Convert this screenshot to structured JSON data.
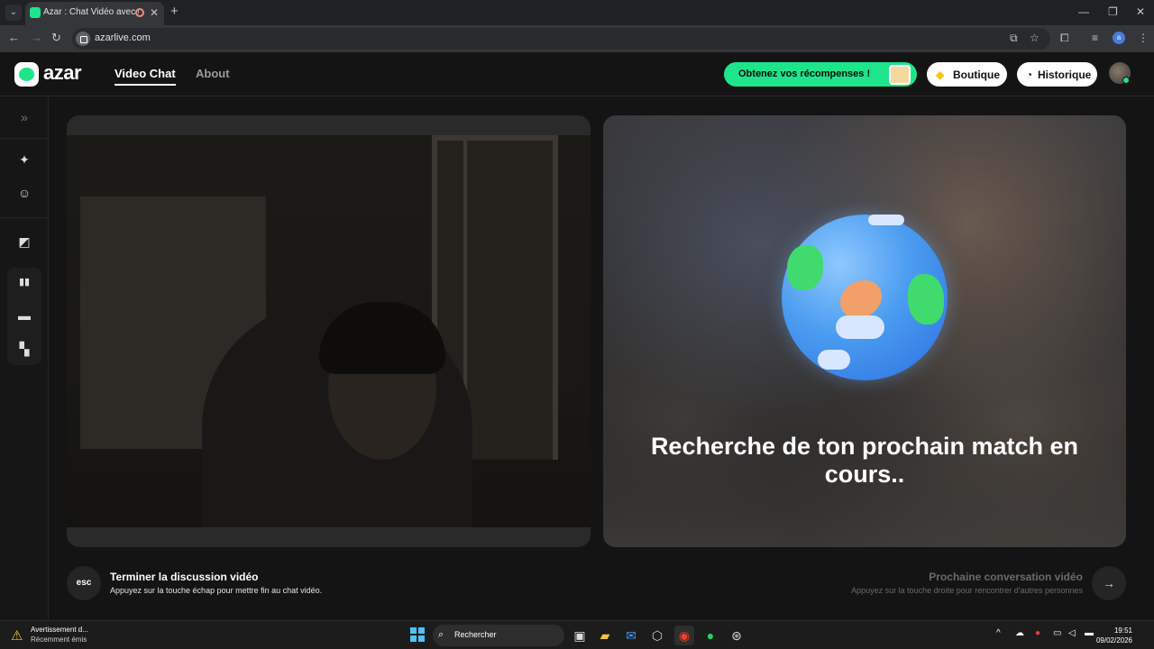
{
  "browser": {
    "tab_title": "Azar : Chat Vidéo avec de",
    "url": "azarlive.com",
    "profile_initial": "a"
  },
  "header": {
    "logo_text": "azar",
    "nav": [
      {
        "label": "Video Chat",
        "active": true
      },
      {
        "label": "About",
        "active": false
      }
    ],
    "rewards_label": "Obtenez vos récompenses !",
    "shop_label": "Boutique",
    "history_label": "Historique"
  },
  "sidebar": {
    "items": [
      {
        "icon": "expand-icon",
        "glyph": "»"
      },
      {
        "icon": "magic-wand-icon",
        "glyph": "✦"
      },
      {
        "icon": "sticker-icon",
        "glyph": "☺"
      },
      {
        "icon": "image-filter-icon",
        "glyph": "◩"
      },
      {
        "icon": "layout-side-by-side-icon",
        "glyph": "▮▮"
      },
      {
        "icon": "layout-stacked-icon",
        "glyph": "▬"
      },
      {
        "icon": "layout-grid-icon",
        "glyph": "▚"
      }
    ]
  },
  "match": {
    "status_text": "Recherche de ton prochain match en cours.."
  },
  "controls": {
    "esc_key": "esc",
    "end_title": "Terminer la discussion vidéo",
    "end_hint": "Appuyez sur la touche échap pour mettre fin au chat vidéo.",
    "next_title": "Prochaine conversation vidéo",
    "next_hint": "Appuyez sur la touche droite pour rencontrer d'autres personnes"
  },
  "taskbar": {
    "notification_title": "Avertissement d...",
    "notification_sub": "Récemment émis",
    "search_placeholder": "Rechercher",
    "time": "19:51",
    "date": "09/02/2026"
  },
  "colors": {
    "accent": "#1ee58b",
    "background": "#141414",
    "panel": "#2a2a2a"
  }
}
